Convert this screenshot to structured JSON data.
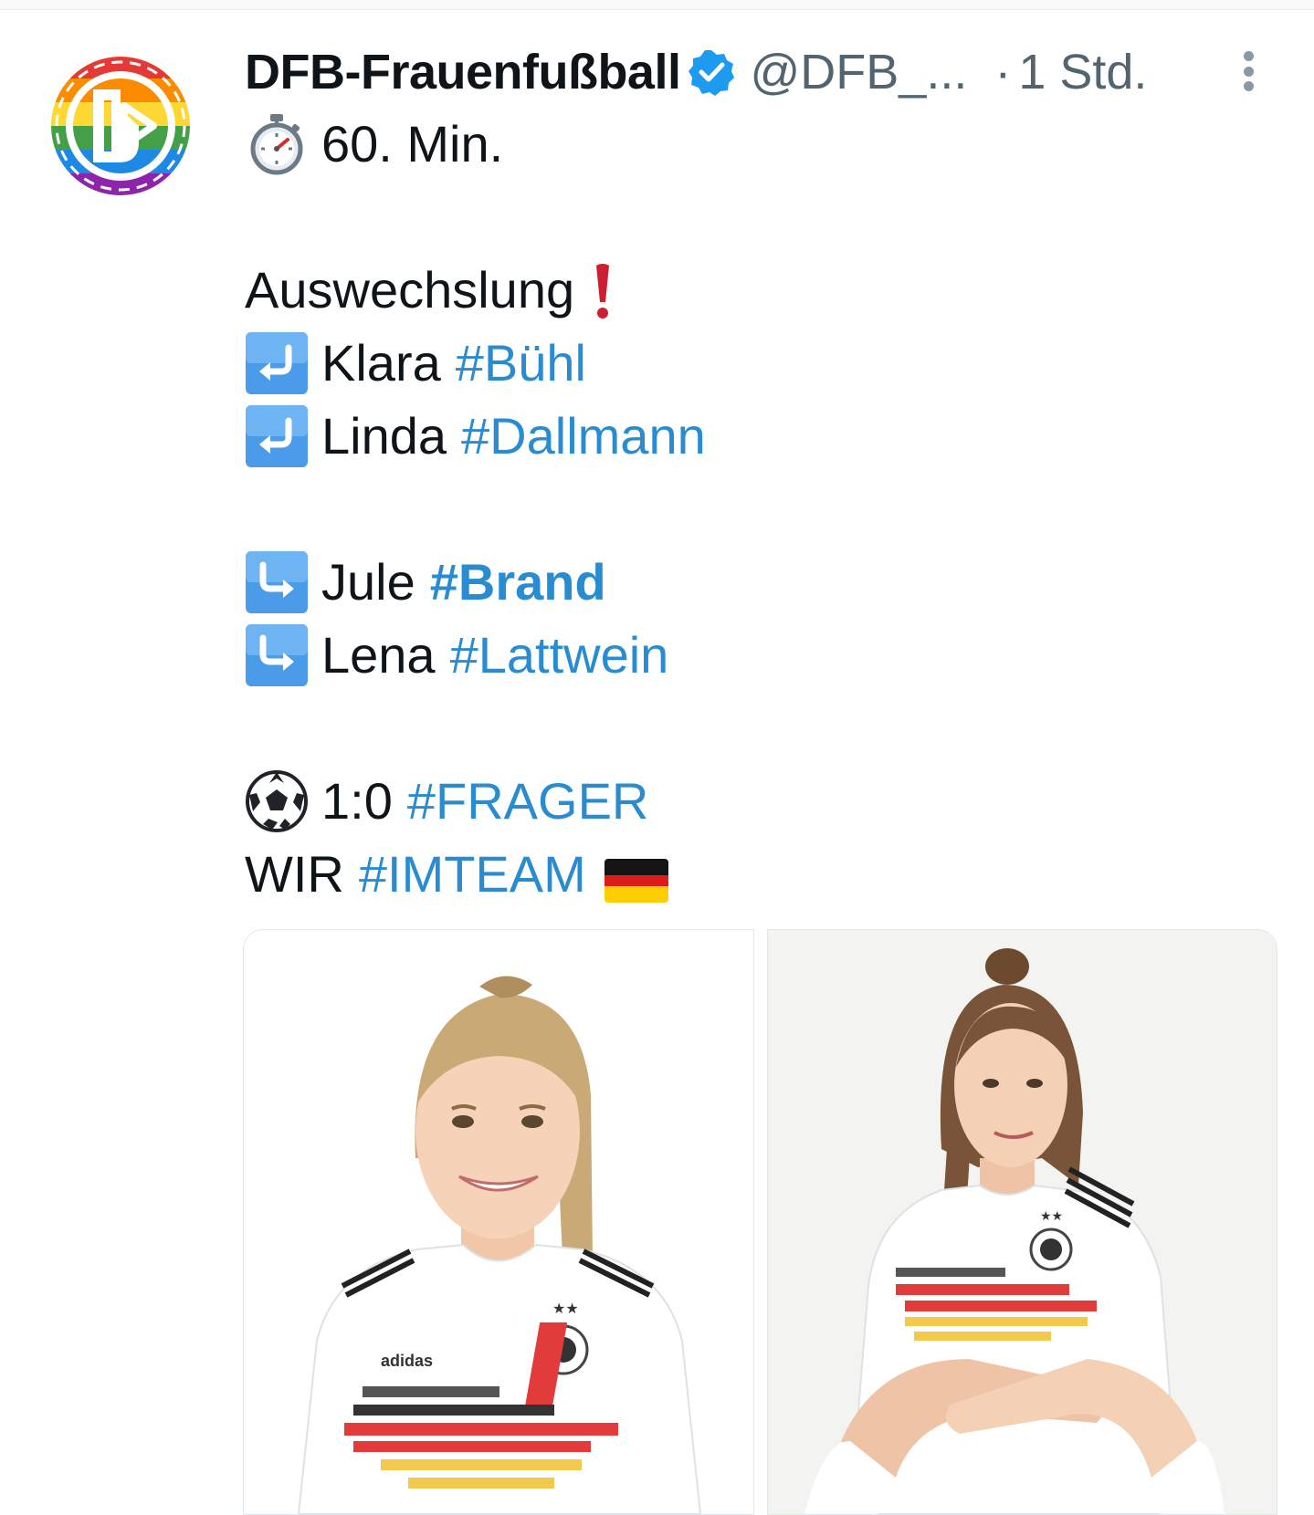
{
  "tweet": {
    "display_name": "DFB-Frauenfußball",
    "handle": "@DFB_...",
    "separator": "·",
    "time": "1 Std.",
    "verified": true,
    "avatar_icon": "dfb-rainbow-logo-icon",
    "more_icon": "more-vertical-icon"
  },
  "body": {
    "minute": "60. Min.",
    "substitution_title": "Auswechslung",
    "off": [
      {
        "first": "Klara",
        "hashtag": "#Bühl"
      },
      {
        "first": "Linda",
        "hashtag": "#Dallmann"
      }
    ],
    "on": [
      {
        "first": "Jule",
        "hashtag": "#Brand"
      },
      {
        "first": "Lena",
        "hashtag": "#Lattwein"
      }
    ],
    "score": "1:0",
    "score_hashtag": "#FRAGER",
    "wir": "WIR",
    "wir_hashtag": "#IMTEAM"
  },
  "icons": {
    "stopwatch": "stopwatch-icon",
    "exclamation": "red-exclamation-icon",
    "arrow_off": "arrow-return-left-icon",
    "arrow_on": "arrow-return-right-icon",
    "ball": "soccer-ball-icon",
    "flag": "germany-flag-icon"
  },
  "colors": {
    "link": "#2a8cd0",
    "secondary": "#536471",
    "verified": "#1d9bf0"
  }
}
